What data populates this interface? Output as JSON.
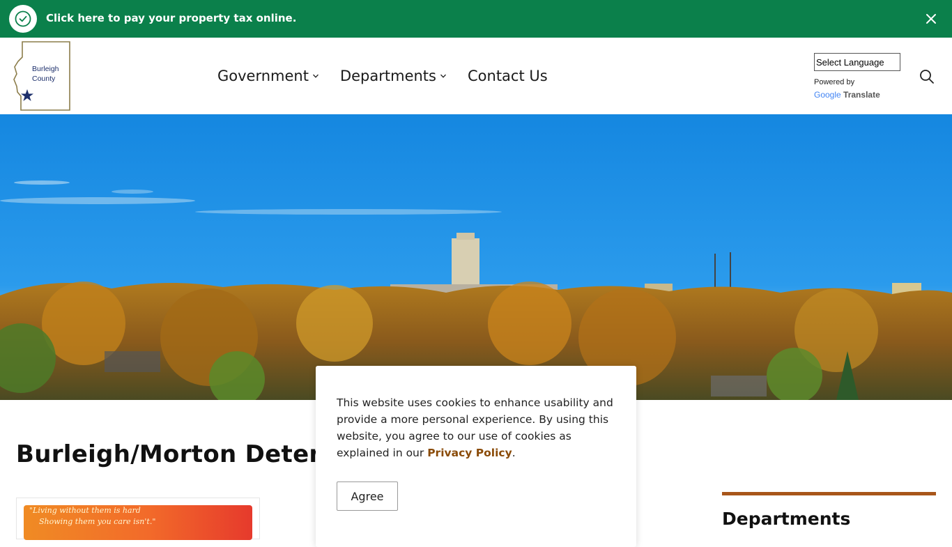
{
  "alert": {
    "text": "Click here to pay your property tax online.",
    "icon": "check-circle-icon",
    "close_icon": "close-icon",
    "background": "#0b804b"
  },
  "header": {
    "logo_line1": "Burleigh",
    "logo_line2": "County",
    "nav": [
      {
        "label": "Government",
        "has_dropdown": true
      },
      {
        "label": "Departments",
        "has_dropdown": true
      },
      {
        "label": "Contact Us",
        "has_dropdown": false
      }
    ],
    "language_select": "Select Language",
    "powered_by": "Powered by",
    "google": "Google",
    "translate": "Translate",
    "search_icon": "search-icon"
  },
  "main": {
    "page_title": "Burleigh/Morton Detention Center",
    "card_quote_line1": "\"Living without them is hard",
    "card_quote_line2": "Showing them you care isn't.\""
  },
  "sidebar": {
    "title": "Departments",
    "accent": "#a8561a"
  },
  "cookie": {
    "text": "This website uses cookies to enhance usability and provide a more personal experience. By using this website, you agree to our use of cookies as explained in our ",
    "link": "Privacy Policy",
    "end": ".",
    "button": "Agree"
  }
}
